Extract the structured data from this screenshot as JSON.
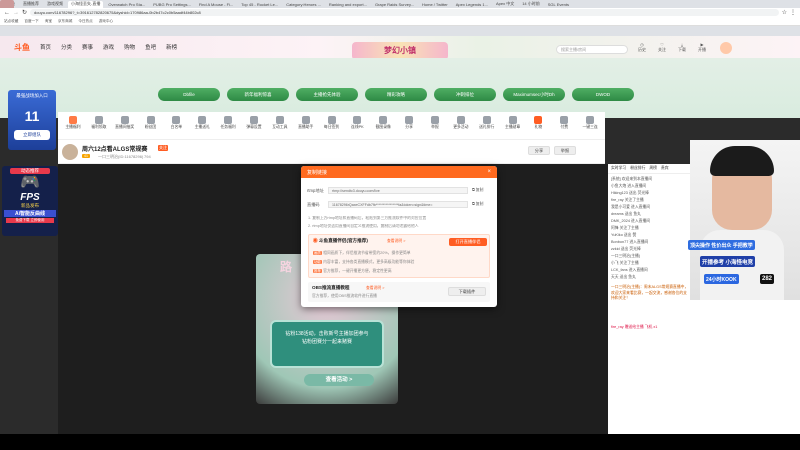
{
  "browser": {
    "tabs": [
      "斗鱼",
      "直播推荐",
      "游戏视频",
      "小海怪丢失-直播",
      "Overwatch Pro Sta...",
      "PUBG Pro Settings...",
      "Find A Mouse - Fi...",
      "Top 45 - Rocket Le...",
      "Category:Heroes ...",
      "Ranking and export...",
      "Grape Raids Survey...",
      "Home / Twitter",
      "Apex Legends 1...",
      "Apex 中文",
      "14 小时前",
      "SGL Events"
    ],
    "active_tab_index": 3,
    "address": "douyu.com/11678296?_t=391612782820675&dyshid=170986aa-0b2b47c2c0b5aadf44b802c8",
    "bookmarks": [
      "站点收藏",
      "百度一下",
      "淘宝",
      "京东商城",
      "今日热点",
      "游戏中心"
    ]
  },
  "site": {
    "logo": "斗鱼",
    "nav": [
      "首页",
      "分类",
      "赛事",
      "游戏",
      "购物",
      "鱼吧",
      "新榜"
    ],
    "search_placeholder": "搜索主播/房间",
    "header_icons": [
      "历史",
      "关注",
      "下载",
      "开播"
    ],
    "banner_title": "梦幻小镇",
    "pills": [
      "Dbfile",
      "新年福利惊喜",
      "主播抢先体验",
      "精彩攻略",
      "冲刺排位",
      "Maximumsec小时Dh",
      "DWOD"
    ]
  },
  "sidepanel": {
    "title": "最强战场加入口",
    "count": "11",
    "btn": "立即组队"
  },
  "toolbar": [
    "主播福利",
    "福利领取",
    "直播间抽奖",
    "粉丝团",
    "白名单",
    "主播送礼",
    "任务福利",
    "弹幕设置",
    "互动工具",
    "直播助手",
    "每日签到",
    "连线PK",
    "截图录像",
    "分享",
    "举报",
    "更多活动",
    "送礼排行",
    "主播勋章",
    "礼物",
    "付费",
    "一键三连",
    "全屏",
    "音量",
    "画质"
  ],
  "room": {
    "title": "周六12点看ALGS常规赛",
    "follow": "关注",
    "meta": "一口三明治(ID:11678296)",
    "fans": "794",
    "share": "分享",
    "report": "举报",
    "level": "41"
  },
  "dialog": {
    "title": "复制链接",
    "rtmp_label": "rtmp地址",
    "rtmp_value": "rtmp://sendtc3.douyu.com/live",
    "key_label": "直播码",
    "key_value": "11678296rQaxeCXFFdb7fb****************fa&token=sign&time=",
    "copy": "复制",
    "note1": "1. 复制上方rtmp地址和直播码后，粘贴到第三方推流软件中的对应位置",
    "note2": "2. rtmp地址仅适用直播间自定义推流使用，复制后请勿泄露给他人",
    "box1_title": "斗鱼直播伴侣(官方推荐)",
    "box1_link": "查看说明 >",
    "box1_btn": "打开直播伴侣",
    "box1_lines": [
      "相同画质下，伴侣推流节省带宽约20%，操作更简单",
      "内容丰富，支持各类直播模式，更多高级功能等你体验",
      "官方推荐，一键开播更方便，稳定性更高"
    ],
    "box1_tags": [
      "画质",
      "功能",
      "推荐"
    ],
    "box2_title": "OBS推流直播教程",
    "box2_link": "查看说明 >",
    "box2_desc": "官方推荐，使用OBS推流软件进行直播",
    "box2_btn": "下载插件"
  },
  "promo": {
    "line1": "钻粉138活动，击败新号主播加团参与",
    "line2": "钻粉团赛分一起来赌赛",
    "btn": "查看活动 >",
    "sign": "路"
  },
  "chat": {
    "tabs": [
      "实时学习",
      "粉丝排行",
      "周榜",
      "贵宾"
    ],
    "lines": [
      "[系统] 欢迎来到本直播间",
      "小鱼大炮 进入直播间",
      "Hiking123 送出 荧光棒",
      "fire_ray 关注了主播",
      "我是小可爱 进入直播间",
      "dreams 送出 鱼丸",
      "DMK_2024 进入直播间",
      "阿锋 关注了主播",
      "YuKiko 送出 赞",
      "Bonbon77 进入直播间",
      "zzkid 送出 荧光棒",
      "一口三明治(主播)",
      "小飞 关注了主播",
      "LCK_fans 进入直播间",
      "天天 送出 鱼丸"
    ],
    "notice": "一口三明治(主播)：周末ALGS常规赛直播中，欢迎大家来看比赛，一起交流，感谢各位的支持和关注！",
    "gift": "fire_ray 赠送给主播 飞机 x1"
  },
  "webcam": {
    "tag1": "顶尖操作 性价出众 手把教学",
    "tag2": "开播参考 小海怪电竞",
    "tag3": "24小时KOOK",
    "tag4": "282"
  },
  "leftad": {
    "top": "动态推荐",
    "title": "FPS",
    "subtitle": "新品发布",
    "line": "Ai智能反曲线",
    "foot": "免费下载 立即使用"
  },
  "colors": {
    "brand_orange": "#ff5d23",
    "pill_green": "#3c9b53",
    "promo_teal": "#2f8f7d"
  }
}
